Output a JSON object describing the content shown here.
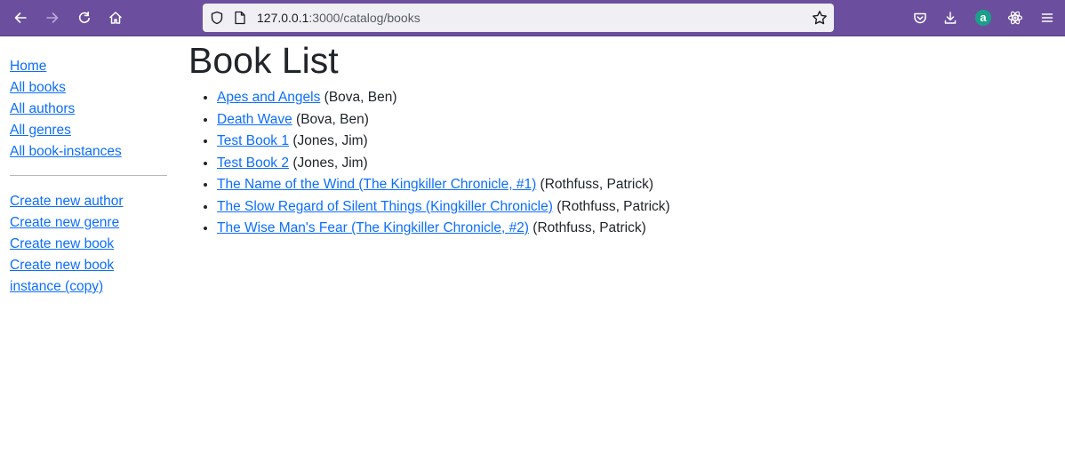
{
  "browser": {
    "url_host": "127.0.0.1",
    "url_path": ":3000/catalog/books",
    "profile_initial": "a",
    "icons": {
      "back": "back-arrow-icon",
      "forward": "forward-arrow-icon",
      "reload": "reload-icon",
      "home": "home-icon",
      "shield": "tracking-shield-icon",
      "page_info": "page-info-icon",
      "bookmark": "bookmark-star-icon",
      "pocket": "pocket-icon",
      "downloads": "download-icon",
      "extension": "react-devtools-icon",
      "menu": "hamburger-menu-icon"
    }
  },
  "sidebar": {
    "nav_links": [
      {
        "label": "Home"
      },
      {
        "label": "All books"
      },
      {
        "label": "All authors"
      },
      {
        "label": "All genres"
      },
      {
        "label": "All book-instances"
      }
    ],
    "create_links": [
      {
        "label": "Create new author"
      },
      {
        "label": "Create new genre"
      },
      {
        "label": "Create new book"
      },
      {
        "label": "Create new book instance (copy)"
      }
    ]
  },
  "main": {
    "title": "Book List",
    "books": [
      {
        "title": "Apes and Angels",
        "author": "(Bova, Ben)"
      },
      {
        "title": "Death Wave",
        "author": "(Bova, Ben)"
      },
      {
        "title": "Test Book 1",
        "author": "(Jones, Jim)"
      },
      {
        "title": "Test Book 2",
        "author": "(Jones, Jim)"
      },
      {
        "title": "The Name of the Wind (The Kingkiller Chronicle, #1)",
        "author": "(Rothfuss, Patrick)"
      },
      {
        "title": "The Slow Regard of Silent Things (Kingkiller Chronicle)",
        "author": "(Rothfuss, Patrick)"
      },
      {
        "title": "The Wise Man's Fear (The Kingkiller Chronicle, #2)",
        "author": "(Rothfuss, Patrick)"
      }
    ]
  },
  "colors": {
    "toolbar": "#6b4f9e",
    "link": "#0d6efd",
    "text": "#212529"
  }
}
